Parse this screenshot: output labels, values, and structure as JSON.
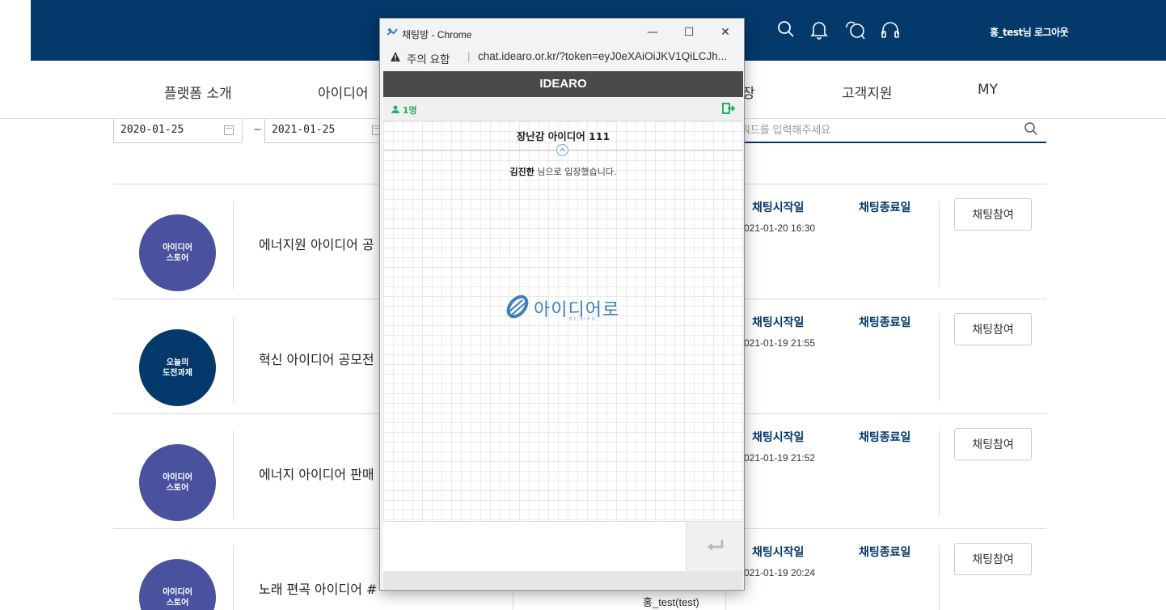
{
  "header": {
    "icons": [
      "search-icon",
      "bell-icon",
      "chat-icon",
      "headset-icon"
    ],
    "user_name": "홍_test님",
    "logout_label": "로그아웃",
    "bg_color": "#03396b"
  },
  "nav": {
    "items": [
      {
        "label": "플랫폼 소개"
      },
      {
        "label": "아이디어"
      },
      {
        "label": "장"
      },
      {
        "label": "고객지원"
      },
      {
        "label": "MY"
      }
    ]
  },
  "filter": {
    "start_date": "2020-01-25",
    "range_sep": "~",
    "end_date": "2021-01-25",
    "search_placeholder": "워드를 입력해주세요"
  },
  "list": {
    "start_label": "채팅시작일",
    "end_label": "채팅종료일",
    "join_label": "채팅참여",
    "rows": [
      {
        "badge": "아이디어\n스토어",
        "badge_color": "#4a52a0",
        "title": "에너지원 아이디어 공",
        "start_date": "021-01-20 16:30"
      },
      {
        "badge": "오늘의\n도전과제",
        "badge_color": "#03396b",
        "title": "혁신 아이디어 공모전",
        "start_date": "021-01-19 21:55"
      },
      {
        "badge": "아이디어\n스토어",
        "badge_color": "#4a52a0",
        "title": "에너지 아이디어 판매",
        "start_date": "021-01-19 21:52"
      },
      {
        "badge": "아이디어\n스토어",
        "badge_color": "#4a52a0",
        "title": "노래 편곡 아이디어 #",
        "start_date": "021-01-19 20:24"
      }
    ],
    "bottom_user": "홍_test(test)"
  },
  "popup": {
    "window_title": "채팅방 - Chrome",
    "minimize": "—",
    "maximize": "☐",
    "close": "✕",
    "warning_text": "주의 요함",
    "url_sep": "|",
    "url": "chat.idearo.or.kr/?token=eyJ0eXAiOiJKV1QiLCJh...",
    "chat_header": "IDEARO",
    "user_count": "1명",
    "room_title": "장난감 아이디어 111",
    "notice_name": "김진한",
    "notice_text": " 님으로 입장했습니다.",
    "logo_text": "아이디어로",
    "logo_sub": "BY KIPO"
  }
}
